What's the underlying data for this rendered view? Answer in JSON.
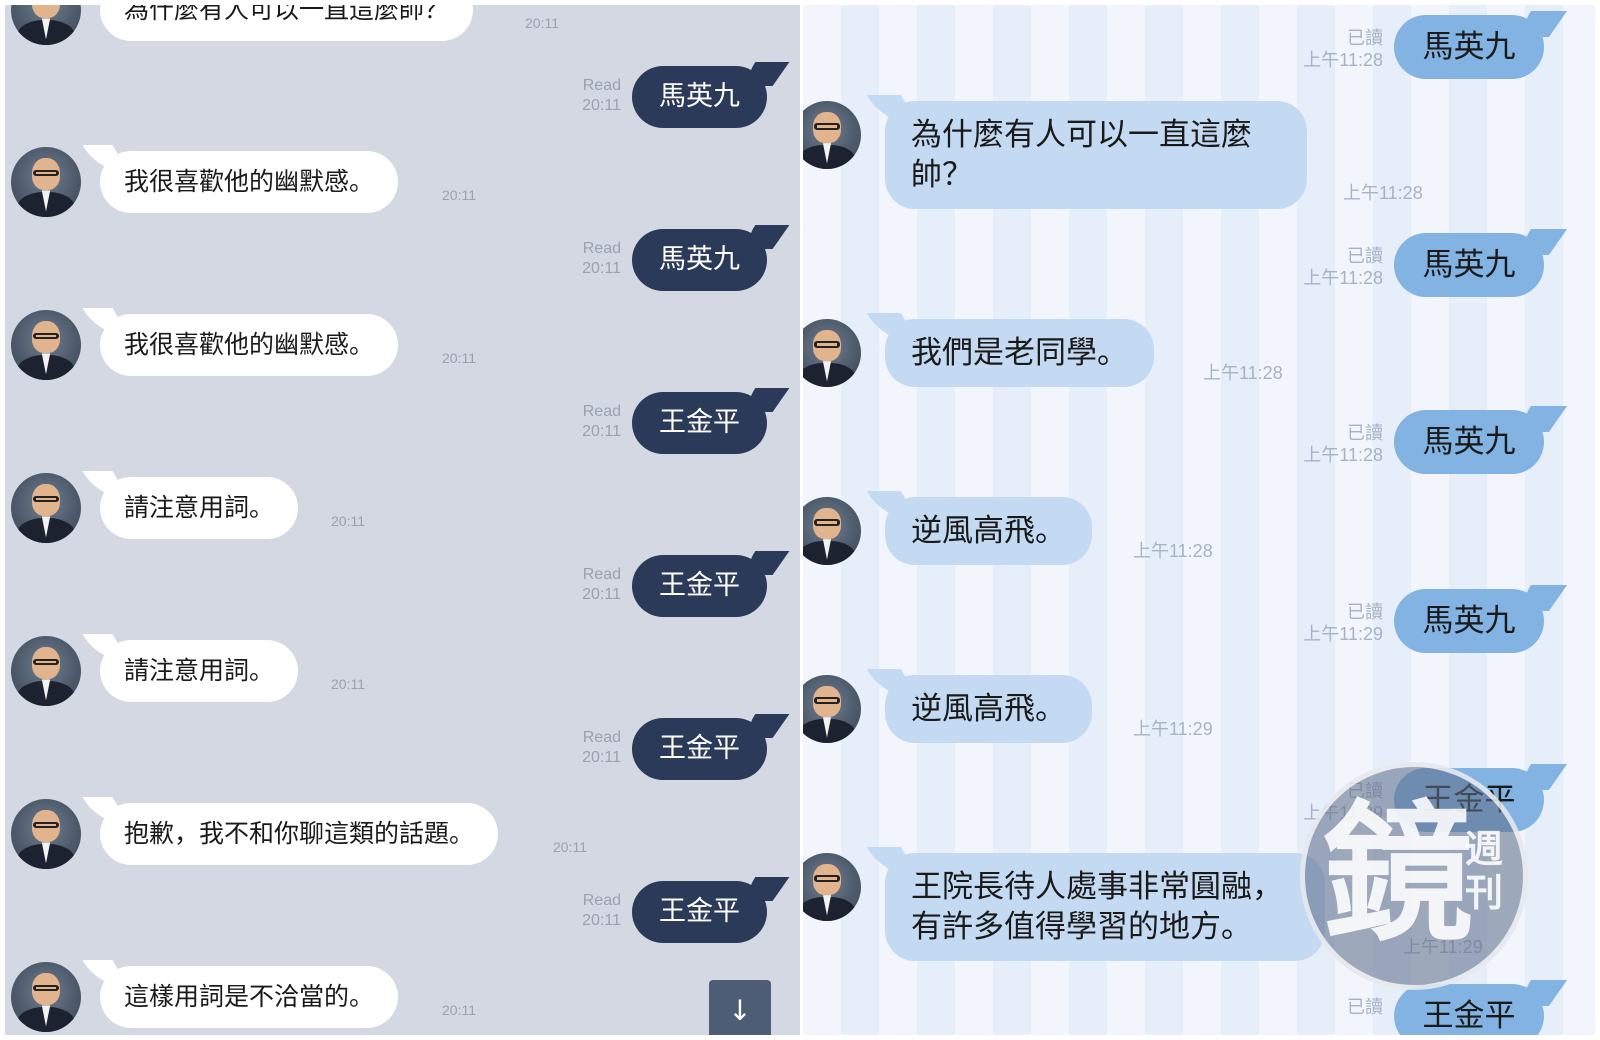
{
  "left_chat": {
    "read_label": "Read",
    "items": [
      {
        "type": "in",
        "text": "為什麼有人可以一直這麼帥？",
        "time": "20:11"
      },
      {
        "type": "out",
        "text": "馬英九",
        "time": "20:11"
      },
      {
        "type": "in",
        "text": "我很喜歡他的幽默感。",
        "time": "20:11"
      },
      {
        "type": "out",
        "text": "馬英九",
        "time": "20:11"
      },
      {
        "type": "in",
        "text": "我很喜歡他的幽默感。",
        "time": "20:11"
      },
      {
        "type": "out",
        "text": "王金平",
        "time": "20:11"
      },
      {
        "type": "in",
        "text": "請注意用詞。",
        "time": "20:11"
      },
      {
        "type": "out",
        "text": "王金平",
        "time": "20:11"
      },
      {
        "type": "in",
        "text": "請注意用詞。",
        "time": "20:11"
      },
      {
        "type": "out",
        "text": "王金平",
        "time": "20:11"
      },
      {
        "type": "in",
        "text": "抱歉，我不和你聊這類的話題。",
        "time": "20:11"
      },
      {
        "type": "out",
        "text": "王金平",
        "time": "20:11"
      },
      {
        "type": "in",
        "text": "這樣用詞是不洽當的。",
        "time": "20:11"
      }
    ],
    "scroll_button_label": "↓"
  },
  "right_chat": {
    "read_label": "已讀",
    "items": [
      {
        "type": "out",
        "text": "馬英九",
        "time": "上午11:28"
      },
      {
        "type": "in",
        "text": "為什麼有人可以一直這麼\n帥？",
        "time": "上午11:28"
      },
      {
        "type": "out",
        "text": "馬英九",
        "time": "上午11:28"
      },
      {
        "type": "in",
        "text": "我們是老同學。",
        "time": "上午11:28"
      },
      {
        "type": "out",
        "text": "馬英九",
        "time": "上午11:28"
      },
      {
        "type": "in",
        "text": "逆風高飛。",
        "time": "上午11:28"
      },
      {
        "type": "out",
        "text": "馬英九",
        "time": "上午11:29"
      },
      {
        "type": "in",
        "text": "逆風高飛。",
        "time": "上午11:29"
      },
      {
        "type": "out",
        "text": "王金平",
        "time": "上午11:29"
      },
      {
        "type": "in",
        "text": "王院長待人處事非常圓融，\n有許多值得學習的地方。",
        "time": "上午11:29"
      },
      {
        "type": "out",
        "text": "王金平",
        "time": ""
      }
    ]
  },
  "watermark": {
    "big": "鏡",
    "small": "週刊"
  }
}
